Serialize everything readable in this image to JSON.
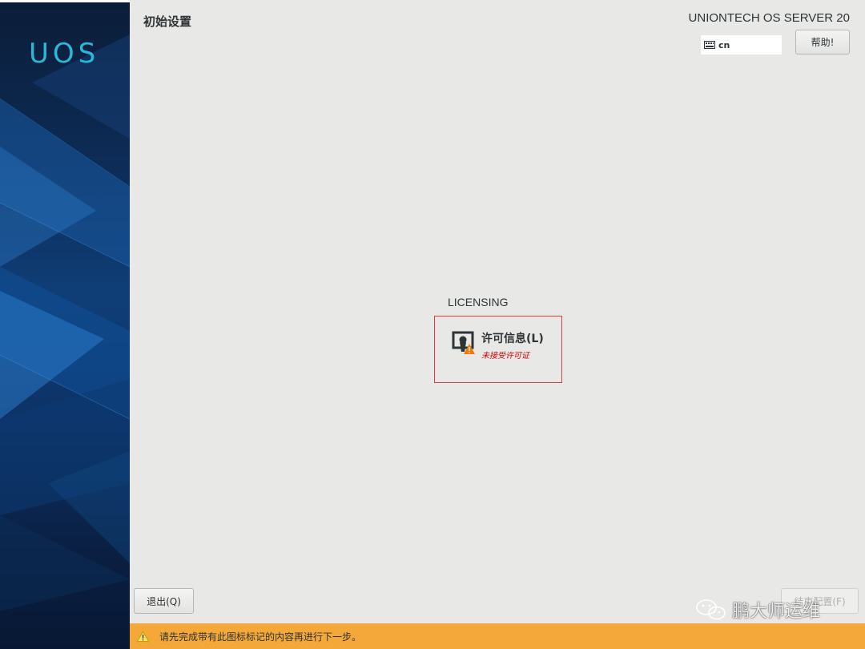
{
  "sidebar": {
    "logo": "UOS"
  },
  "header": {
    "title": "初始设置",
    "product": "UNIONTECH OS SERVER 20",
    "keyboard_layout": "cn",
    "help_label": "帮助!"
  },
  "hub": {
    "category": "LICENSING",
    "spoke": {
      "name": "许可信息(L)",
      "status": "未接受许可证",
      "icon": "license-warning-icon"
    }
  },
  "footer": {
    "quit_label": "退出(Q)",
    "finish_label": "结束配置(F)",
    "warning_text": "请先完成带有此图标标记的内容再进行下一步。",
    "watermark": "鹏大师运维"
  },
  "colors": {
    "warning_bar": "#f5a83a",
    "error_red": "#cc0000",
    "spoke_border": "#e33b36",
    "logo": "#2bb7d8"
  }
}
